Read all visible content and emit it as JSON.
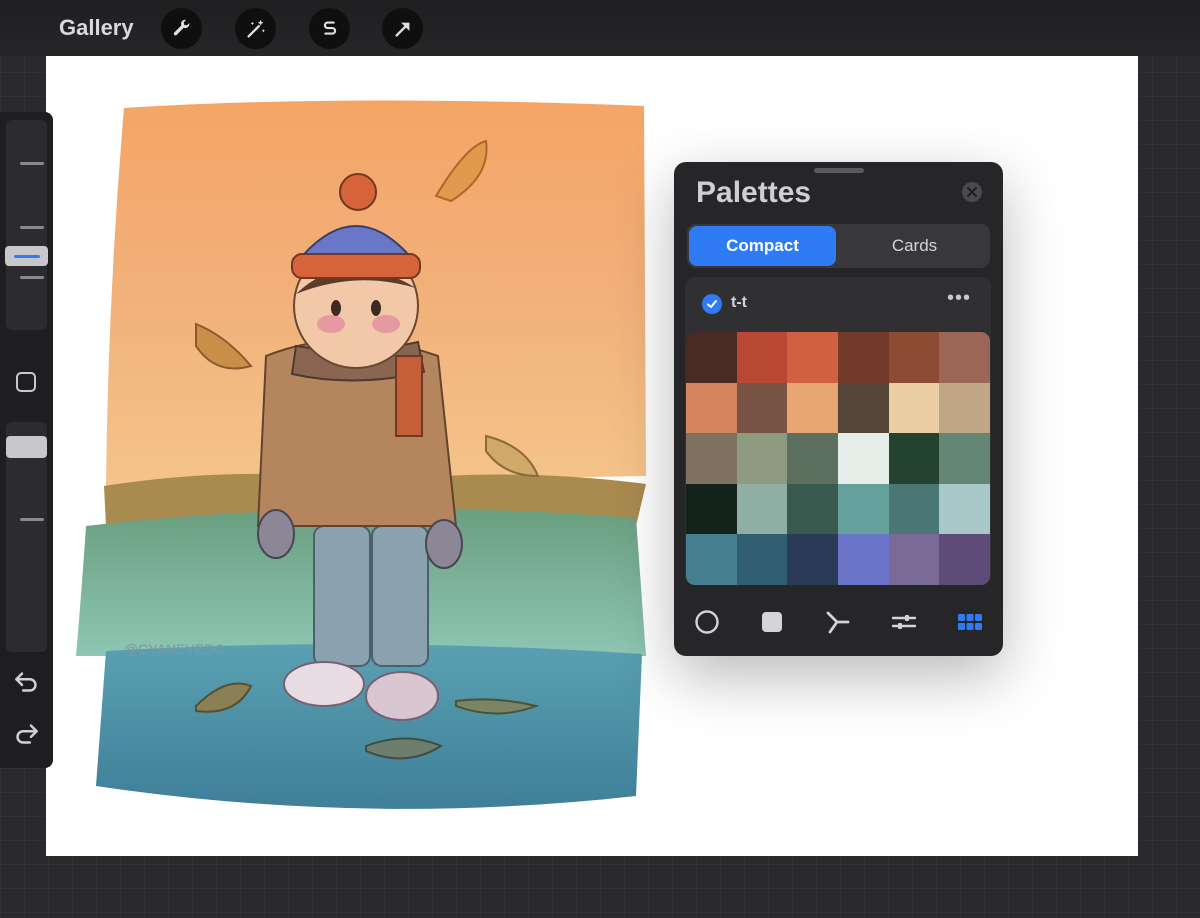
{
  "toolbar": {
    "gallery_label": "Gallery",
    "tools": [
      {
        "name": "wrench-icon"
      },
      {
        "name": "magic-wand-icon"
      },
      {
        "name": "selection-s-icon"
      },
      {
        "name": "transform-arrow-icon"
      }
    ]
  },
  "sidebar": {
    "icons": [
      "square-icon",
      "undo-icon",
      "redo-icon"
    ]
  },
  "canvas": {
    "watermark": "@CYANEYEDC"
  },
  "palettes": {
    "title": "Palettes",
    "tabs": {
      "compact": "Compact",
      "cards": "Cards",
      "active": "Compact"
    },
    "palette_name": "t-t",
    "more_label": "•••",
    "swatches": [
      "#4a2a25",
      "#b84733",
      "#cf6141",
      "#73392a",
      "#8d4a34",
      "#9b6655",
      "#d4855c",
      "#795445",
      "#e8a673",
      "#554539",
      "#eccea5",
      "#c0a887",
      "#7f715f",
      "#8e9b81",
      "#5d6f5e",
      "#e5eee9",
      "#23432f",
      "#648674",
      "#13221b",
      "#8fafa4",
      "#3a5a50",
      "#64a19d",
      "#4a7775",
      "#a9c6c9",
      "#457f8f",
      "#315d73",
      "#2b3a56",
      "#6a75c9",
      "#7a6a97",
      "#5c4c77"
    ],
    "bottom_tabs": [
      "disc-icon",
      "classic-icon",
      "harmony-icon",
      "value-icon",
      "palettes-icon"
    ],
    "accent": "#2f7bf5"
  }
}
